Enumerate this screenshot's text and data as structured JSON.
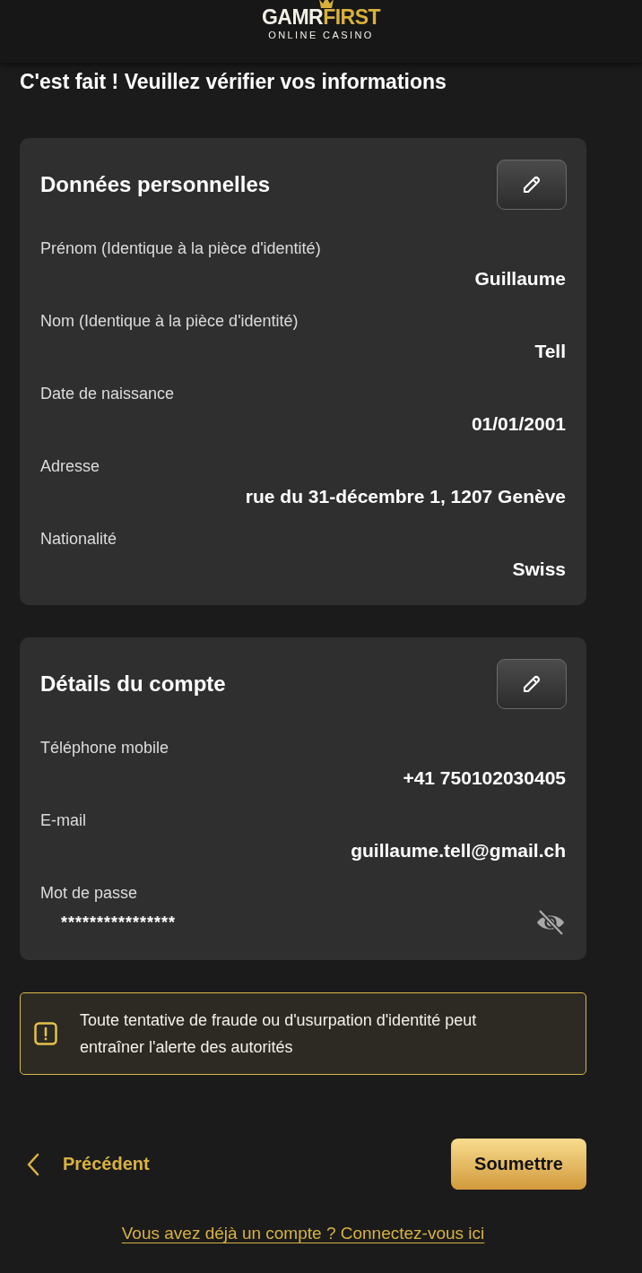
{
  "header": {
    "logo": {
      "word_1": "GAMR",
      "word_2": "FIRST",
      "tagline": "ONLINE CASINO"
    }
  },
  "title": "C'est fait ! Veuillez vérifier vos informations",
  "sections": [
    {
      "heading": "Données personnelles",
      "fields": [
        {
          "kind": "text",
          "label": "Prénom (Identique à la pièce d'identité)",
          "value": "Guillaume"
        },
        {
          "kind": "text",
          "label": "Nom (Identique à la pièce d'identité)",
          "value": "Tell"
        },
        {
          "kind": "text",
          "label": "Date de naissance",
          "value": "01/01/2001"
        },
        {
          "kind": "text",
          "label": "Adresse",
          "value": "rue du 31-décembre 1, 1207 Genève"
        },
        {
          "kind": "text",
          "label": "Nationalité",
          "value": "Swiss"
        }
      ]
    },
    {
      "heading": "Détails du compte",
      "fields": [
        {
          "kind": "text",
          "label": "Téléphone mobile",
          "value": "+41 750102030405"
        },
        {
          "kind": "text",
          "label": "E-mail",
          "value": "guillaume.tell@gmail.ch"
        },
        {
          "kind": "password",
          "label": "Mot de passe",
          "value": "****************",
          "revealed": false
        }
      ]
    }
  ],
  "alert": {
    "text": "Toute tentative de fraude ou d'usurpation d'identité peut entraîner l'alerte des autorités"
  },
  "nav": {
    "back": "Précédent",
    "submit": "Soumettre"
  },
  "login_link": "Vous avez déjà un compte ? Connectez-vous ici"
}
